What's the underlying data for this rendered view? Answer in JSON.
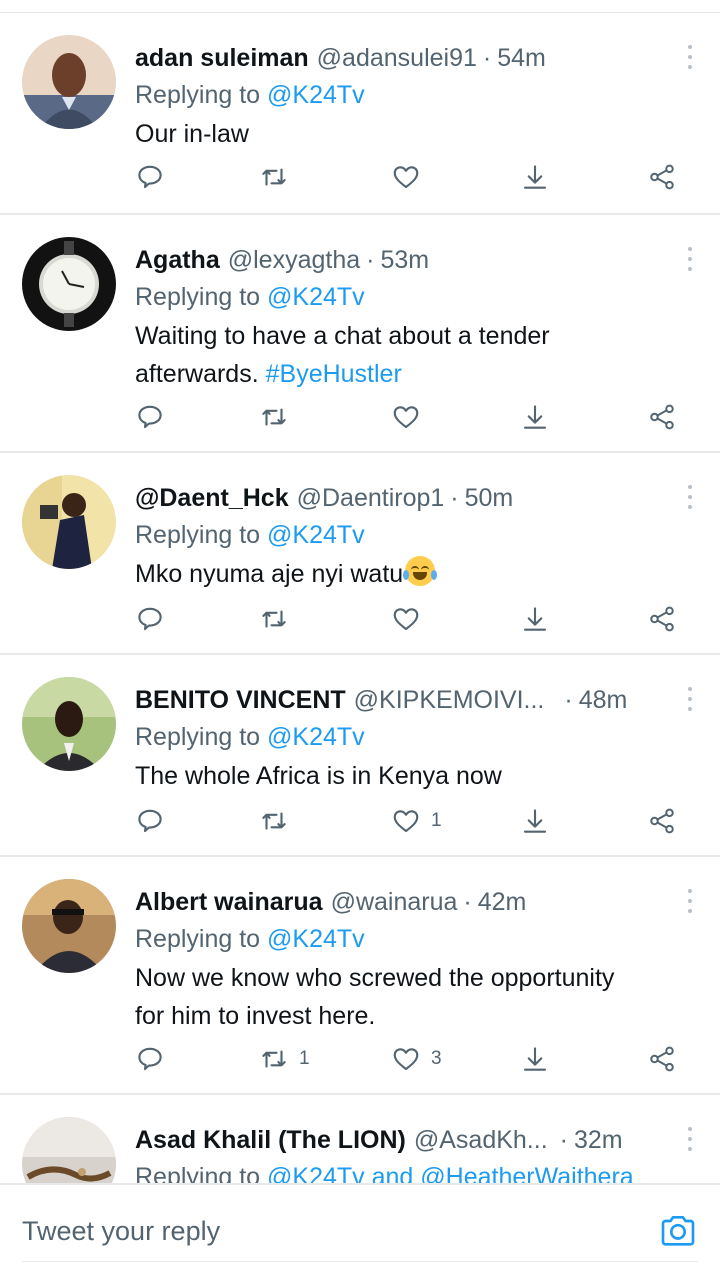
{
  "colors": {
    "accent": "#1d9bf0",
    "text_primary": "#0f1419",
    "text_secondary": "#536471",
    "divider": "#e7e9ea"
  },
  "replies": [
    {
      "name": "adan suleiman",
      "handle": "@adansulei91",
      "time": "54m",
      "replying_label": "Replying to ",
      "replying_to": "@K24Tv",
      "text": "Our in-law",
      "reply_count": "",
      "retweet_count": "",
      "like_count": ""
    },
    {
      "name": "Agatha",
      "handle": "@lexyagtha",
      "time": "53m",
      "replying_label": "Replying to ",
      "replying_to": "@K24Tv",
      "text_line1": "Waiting to have a chat about a tender",
      "text_line2": "afterwards. ",
      "hashtag": "#ByeHustler",
      "reply_count": "",
      "retweet_count": "",
      "like_count": ""
    },
    {
      "name": "@Daent_Hck",
      "handle": "@Daentirop1",
      "time": "50m",
      "replying_label": "Replying to ",
      "replying_to": "@K24Tv",
      "text": "Mko nyuma aje nyi watu",
      "emoji": "face-with-tears-of-joy",
      "reply_count": "",
      "retweet_count": "",
      "like_count": ""
    },
    {
      "name": "BENITO VINCENT",
      "handle": "@KIPKEMOIVI...",
      "time": "48m",
      "replying_label": "Replying to ",
      "replying_to": "@K24Tv",
      "text": "The whole Africa is in Kenya now",
      "reply_count": "",
      "retweet_count": "",
      "like_count": "1"
    },
    {
      "name": "Albert wainarua",
      "handle": "@wainarua",
      "time": "42m",
      "replying_label": "Replying to ",
      "replying_to": "@K24Tv",
      "text_line1": "Now we know who screwed the opportunity",
      "text_line2": "for him to invest here.",
      "reply_count": "",
      "retweet_count": "1",
      "like_count": "3"
    },
    {
      "name": "Asad Khalil (The LION)",
      "handle": "@AsadKh...",
      "time": "32m",
      "replying_label": "Replying to ",
      "replying_to": "@K24Tv and @HeatherWaithera"
    }
  ],
  "reply_box": {
    "placeholder": "Tweet your reply",
    "camera_icon": "camera-icon"
  }
}
